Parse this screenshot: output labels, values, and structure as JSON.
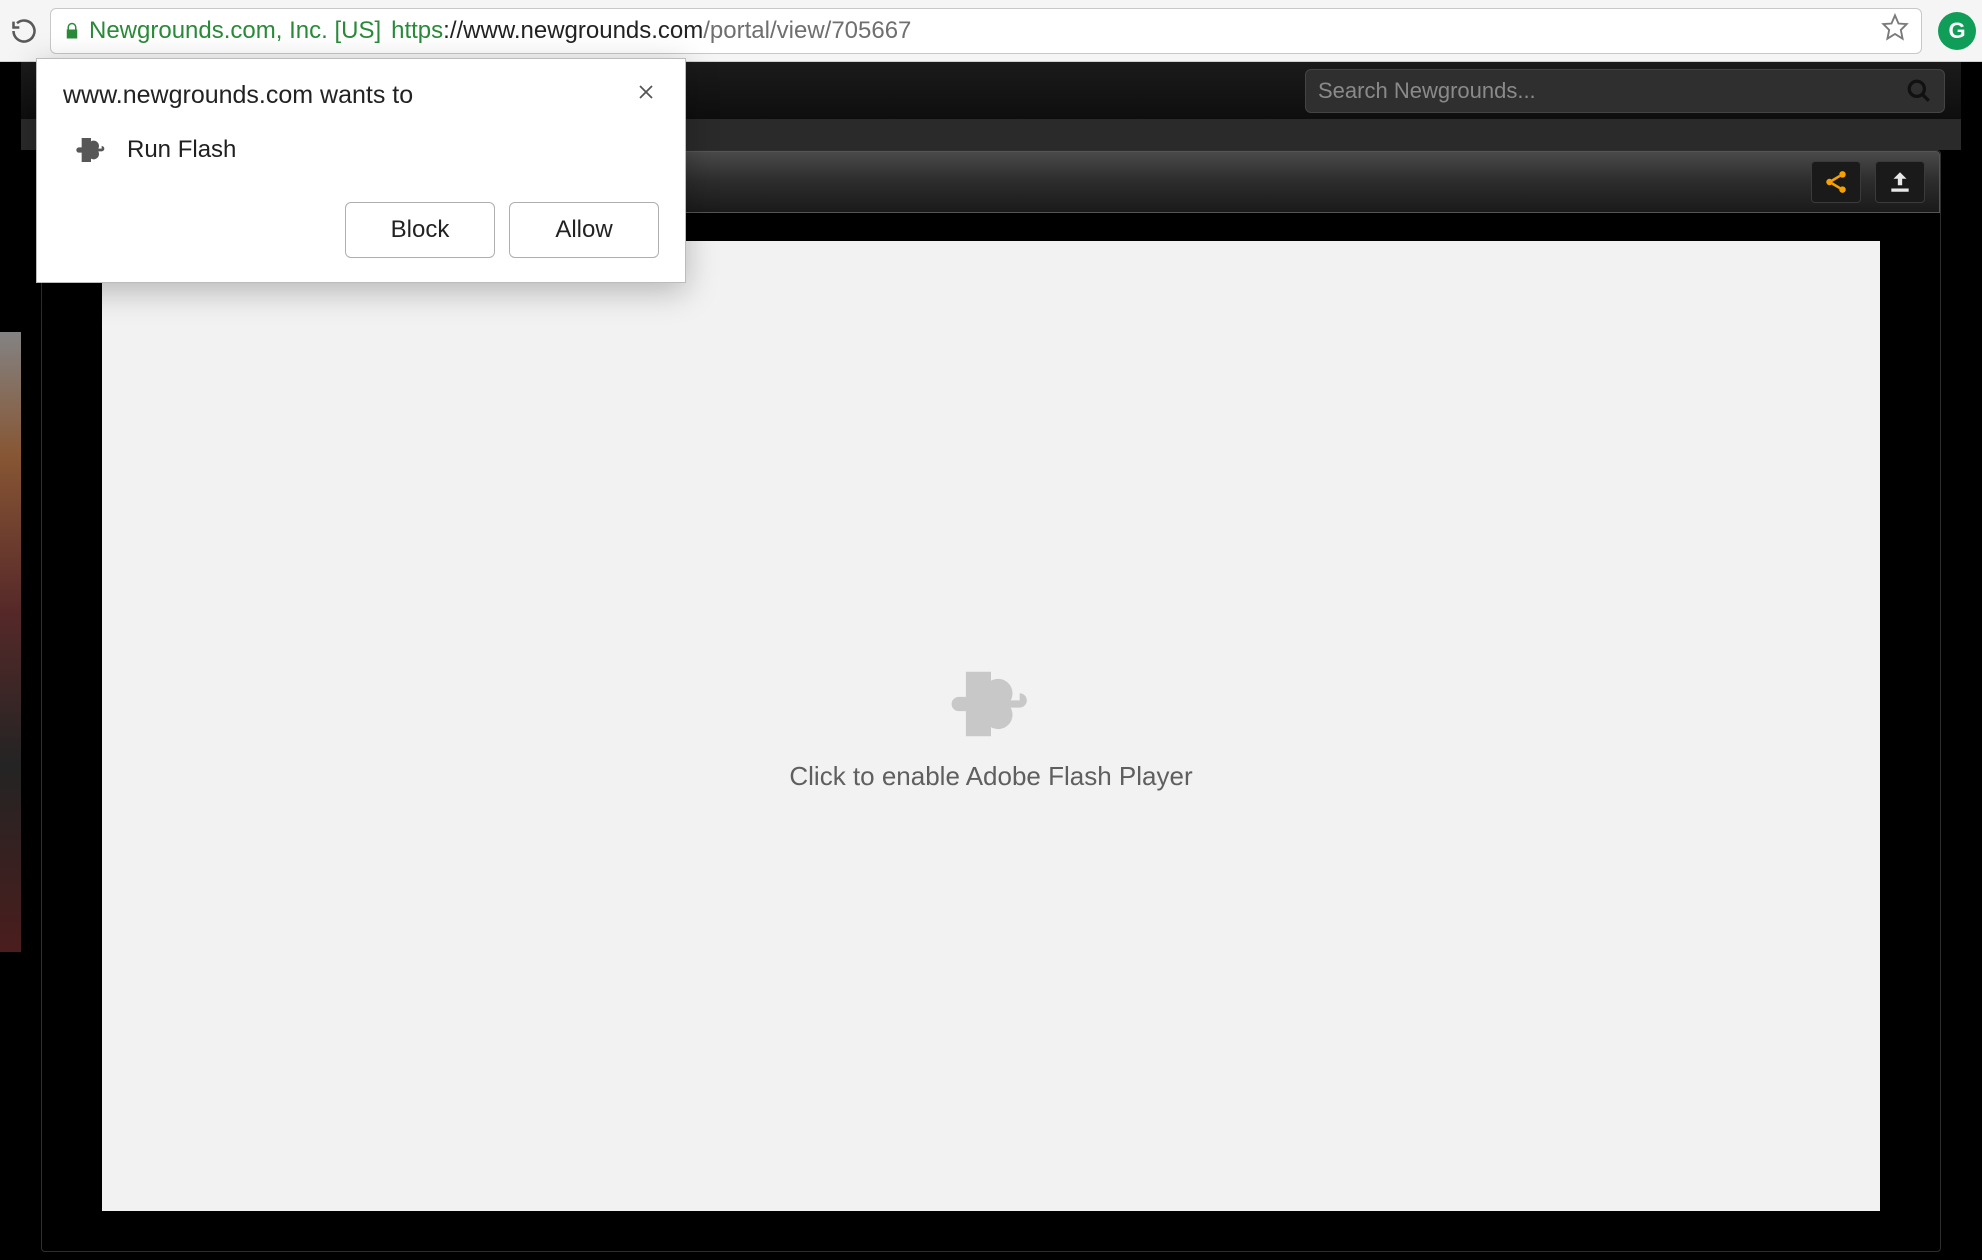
{
  "browser": {
    "ev_cert_name": "Newgrounds.com, Inc. [US]",
    "url_scheme": "https",
    "url_host": "://www.newgrounds.com",
    "url_path": "/portal/view/705667",
    "ext_label": "G"
  },
  "site": {
    "search_placeholder": "Search Newgrounds..."
  },
  "flash": {
    "message": "Click to enable Adobe Flash Player"
  },
  "permission": {
    "title": "www.newgrounds.com wants to",
    "item_label": "Run Flash",
    "block_label": "Block",
    "allow_label": "Allow"
  }
}
